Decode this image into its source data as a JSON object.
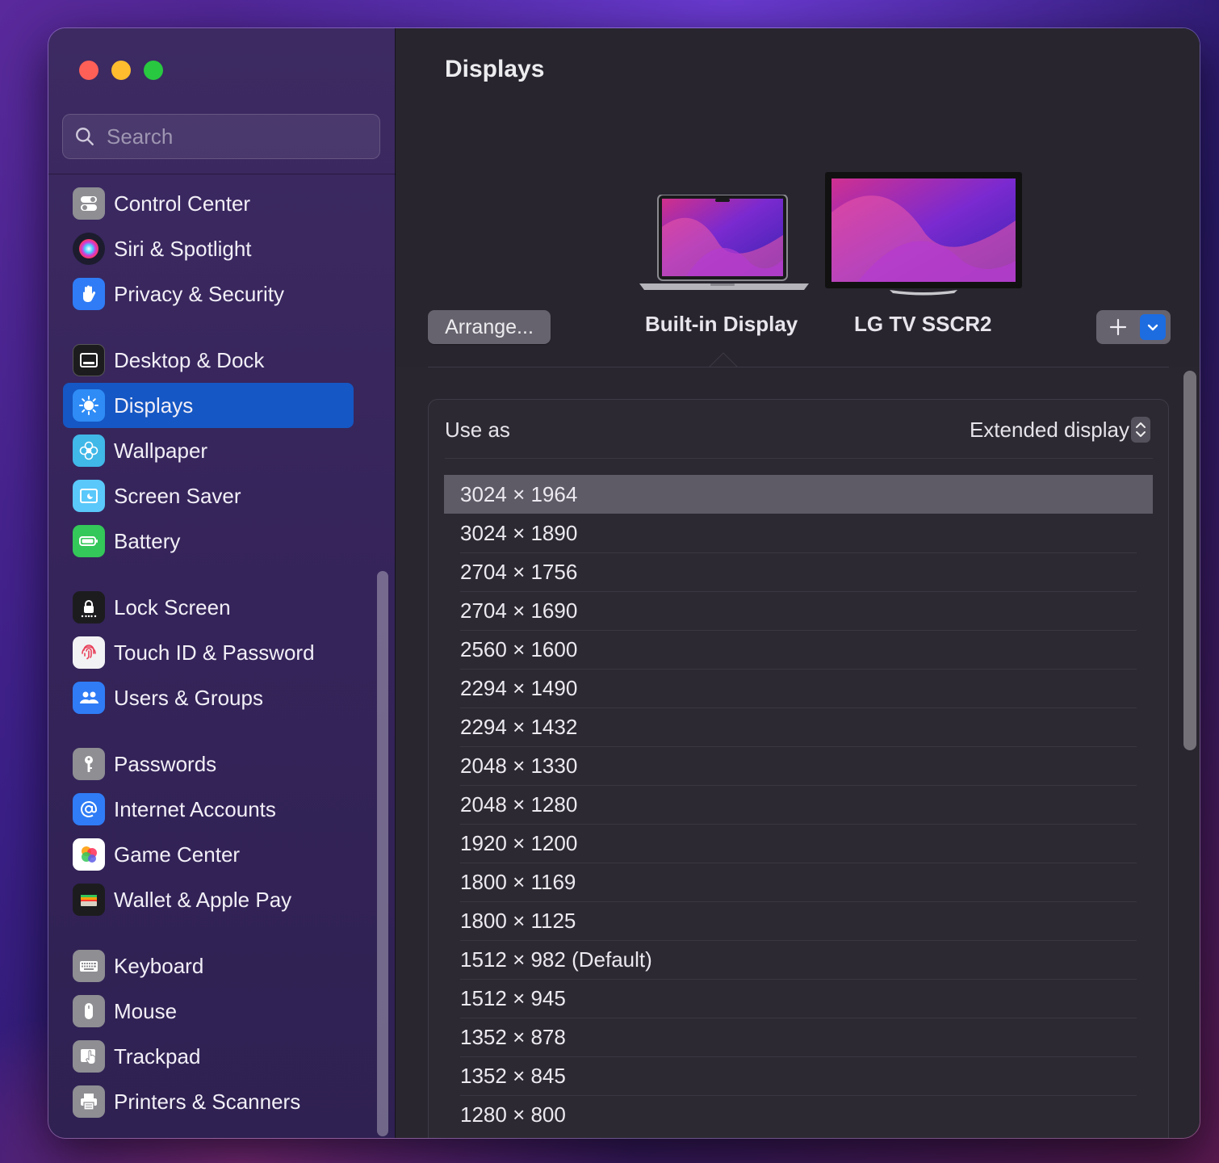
{
  "search": {
    "placeholder": "Search"
  },
  "sidebar": {
    "items": [
      {
        "label": "Control Center",
        "icon": "control-center-icon",
        "color": "#8e8e93"
      },
      {
        "label": "Siri & Spotlight",
        "icon": "siri-icon",
        "color": "#1c1c2e"
      },
      {
        "label": "Privacy & Security",
        "icon": "hand-icon",
        "color": "#2f7cf6"
      },
      {
        "label": "Desktop & Dock",
        "icon": "dock-icon",
        "color": "#1c1c1e"
      },
      {
        "label": "Displays",
        "icon": "brightness-icon",
        "color": "#2f8cf6"
      },
      {
        "label": "Wallpaper",
        "icon": "flower-icon",
        "color": "#40b8e8"
      },
      {
        "label": "Screen Saver",
        "icon": "screen-saver-icon",
        "color": "#5ac8fa"
      },
      {
        "label": "Battery",
        "icon": "battery-icon",
        "color": "#34c759"
      },
      {
        "label": "Lock Screen",
        "icon": "lock-icon",
        "color": "#1c1c1e"
      },
      {
        "label": "Touch ID & Password",
        "icon": "fingerprint-icon",
        "color": "#f2f2f4"
      },
      {
        "label": "Users & Groups",
        "icon": "users-icon",
        "color": "#2f7cf6"
      },
      {
        "label": "Passwords",
        "icon": "key-icon",
        "color": "#8e8e93"
      },
      {
        "label": "Internet Accounts",
        "icon": "at-icon",
        "color": "#2f7cf6"
      },
      {
        "label": "Game Center",
        "icon": "game-center-icon",
        "color": "#ffffff"
      },
      {
        "label": "Wallet & Apple Pay",
        "icon": "wallet-icon",
        "color": "#1c1c1e"
      },
      {
        "label": "Keyboard",
        "icon": "keyboard-icon",
        "color": "#8e8e93"
      },
      {
        "label": "Mouse",
        "icon": "mouse-icon",
        "color": "#8e8e93"
      },
      {
        "label": "Trackpad",
        "icon": "trackpad-icon",
        "color": "#8e8e93"
      },
      {
        "label": "Printers & Scanners",
        "icon": "printer-icon",
        "color": "#8e8e93"
      }
    ],
    "active": "Displays"
  },
  "main": {
    "title": "Displays",
    "arrange_label": "Arrange...",
    "displays": [
      {
        "name": "Built-in Display",
        "selected": true
      },
      {
        "name": "LG TV SSCR2",
        "selected": false
      }
    ],
    "use_as": {
      "label": "Use as",
      "value": "Extended display"
    },
    "resolutions": [
      "3024 × 1964",
      "3024 × 1890",
      "2704 × 1756",
      "2704 × 1690",
      "2560 × 1600",
      "2294 × 1490",
      "2294 × 1432",
      "2048 × 1330",
      "2048 × 1280",
      "1920 × 1200",
      "1800 × 1169",
      "1800 × 1125",
      "1512 × 982 (Default)",
      "1512 × 945",
      "1352 × 878",
      "1352 × 845",
      "1280 × 800"
    ],
    "selected_resolution": "3024 × 1964"
  },
  "colors": {
    "accent": "#1557c4",
    "window_bg": "#2a2630"
  }
}
